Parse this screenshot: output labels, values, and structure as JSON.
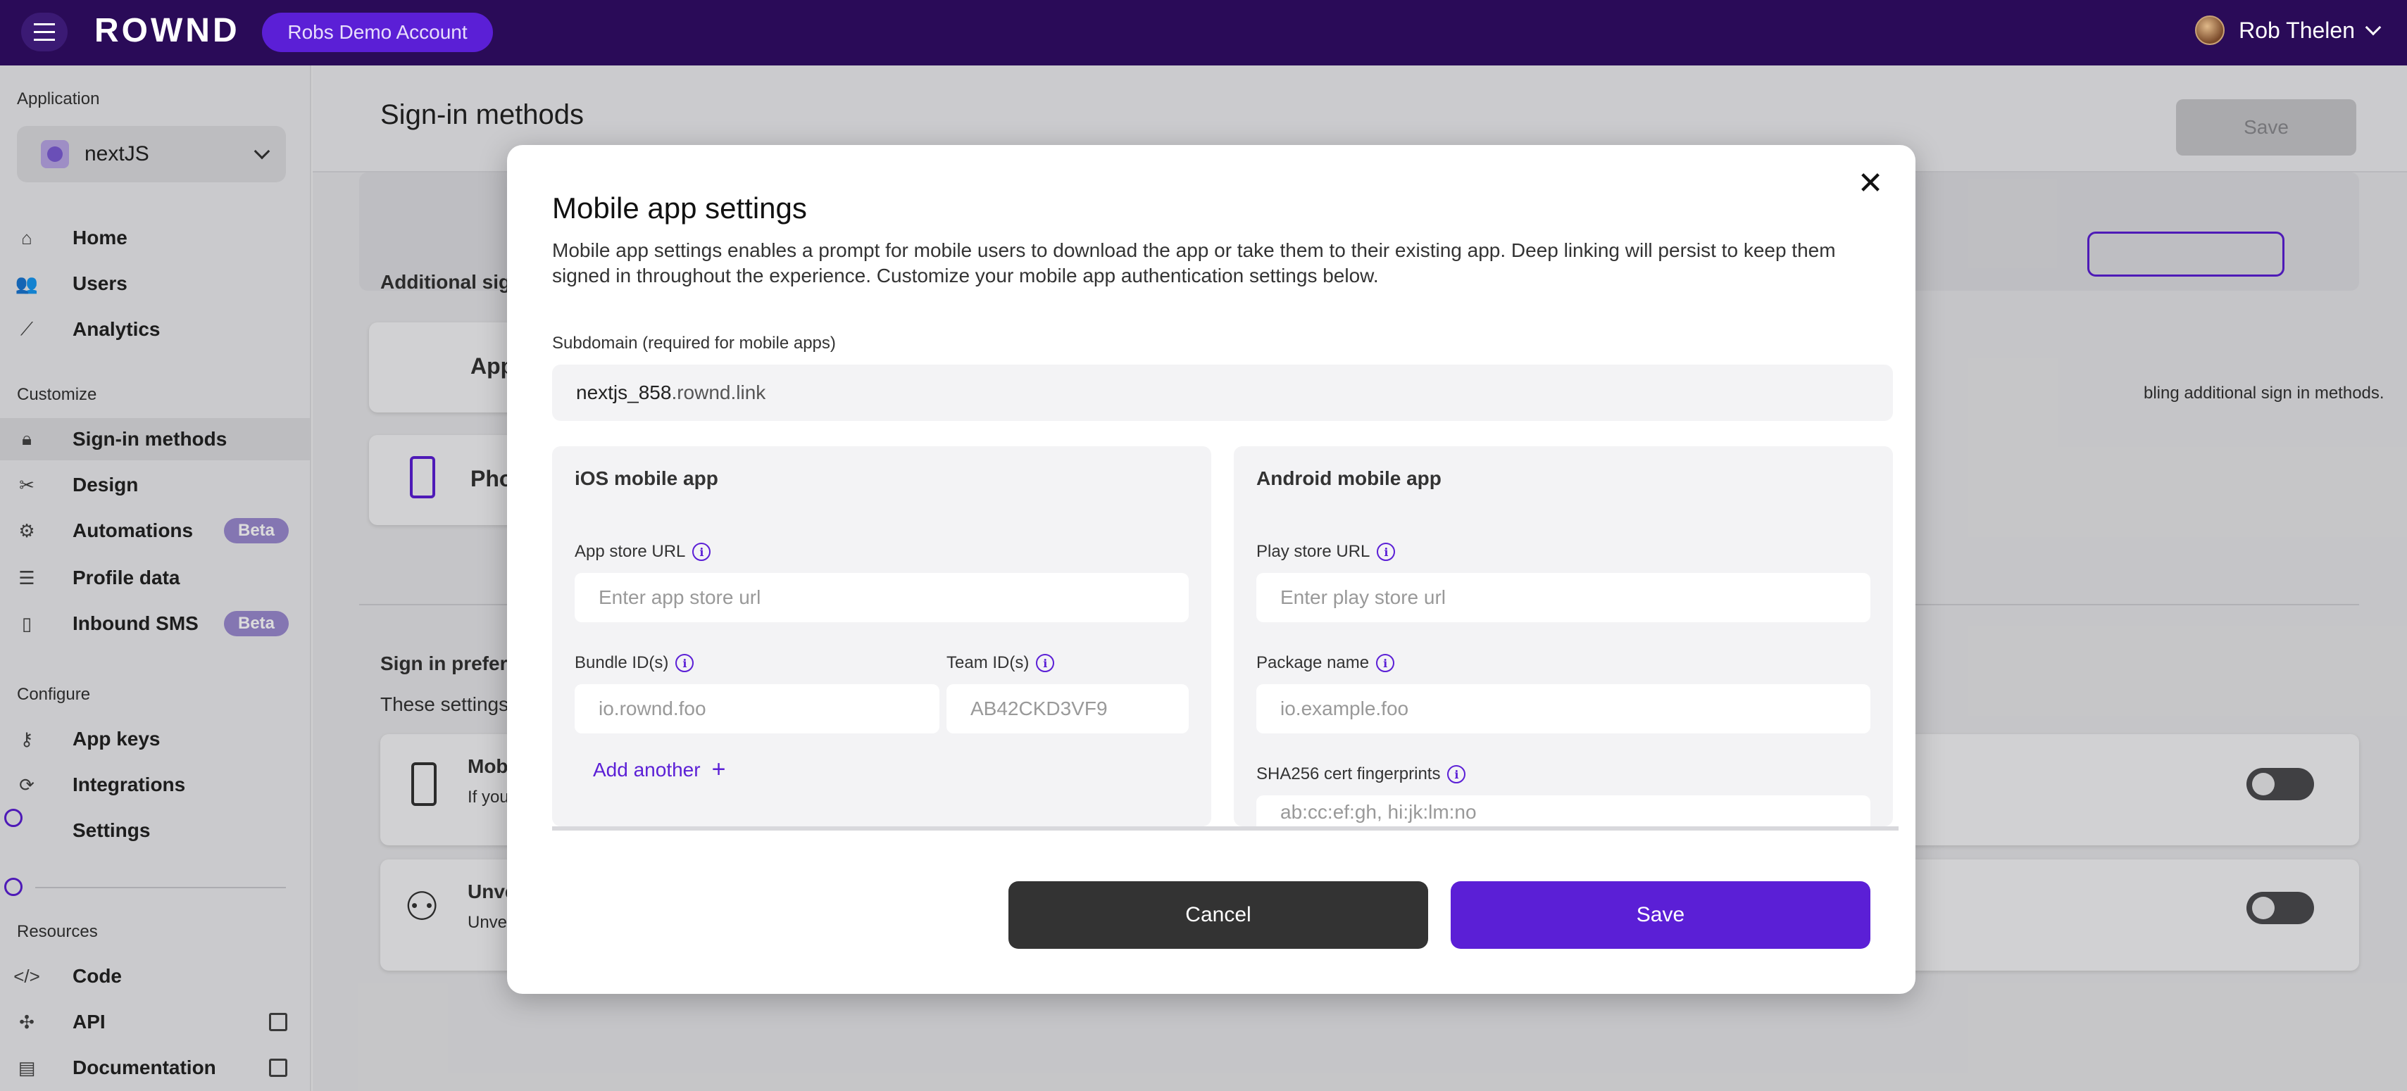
{
  "topbar": {
    "logo": "ROWND",
    "account": "Robs Demo Account",
    "user_name": "Rob Thelen"
  },
  "sidebar": {
    "application_label": "Application",
    "app_name": "nextJS",
    "main_items": [
      {
        "label": "Home",
        "icon": "home-icon"
      },
      {
        "label": "Users",
        "icon": "users-icon"
      },
      {
        "label": "Analytics",
        "icon": "analytics-icon"
      }
    ],
    "customize_label": "Customize",
    "customize_items": [
      {
        "label": "Sign-in methods",
        "icon": "lock-icon",
        "active": true
      },
      {
        "label": "Design",
        "icon": "design-icon"
      },
      {
        "label": "Automations",
        "icon": "automations-icon",
        "badge": "Beta"
      },
      {
        "label": "Profile data",
        "icon": "list-icon"
      },
      {
        "label": "Inbound SMS",
        "icon": "phone-icon",
        "badge": "Beta"
      }
    ],
    "configure_label": "Configure",
    "configure_items": [
      {
        "label": "App keys",
        "icon": "key-icon"
      },
      {
        "label": "Integrations",
        "icon": "integrations-icon"
      },
      {
        "label": "Settings",
        "icon": "settings-icon"
      }
    ],
    "resources_label": "Resources",
    "resources_items": [
      {
        "label": "Code",
        "icon": "code-icon"
      },
      {
        "label": "API",
        "icon": "api-icon",
        "external": true
      },
      {
        "label": "Documentation",
        "icon": "doc-icon",
        "external": true
      }
    ]
  },
  "page": {
    "title": "Sign-in methods",
    "save": "Save",
    "additional_heading": "Additional sign",
    "apple_label": "App",
    "phone_label": "Pho",
    "enabling_note": "bling additional sign in methods.",
    "prefs_heading": "Sign in prefere",
    "prefs_sub": "These settings",
    "mobile_title": "Mob",
    "mobile_sub": "If you",
    "unverified_title": "Unve",
    "unverified_sub": "Unve"
  },
  "modal": {
    "title": "Mobile app settings",
    "description": "Mobile app settings enables a prompt for mobile users to download the app or take them to their existing app. Deep linking will persist to keep them signed in throughout the experience. Customize your mobile app authentication settings below.",
    "subdomain_label": "Subdomain (required for mobile apps)",
    "subdomain_value": "nextjs_858",
    "subdomain_suffix": ".rownd.link",
    "ios": {
      "title": "iOS mobile app",
      "app_store_label": "App store URL",
      "app_store_placeholder": "Enter app store url",
      "bundle_label": "Bundle ID(s)",
      "bundle_placeholder": "io.rownd.foo",
      "team_label": "Team ID(s)",
      "team_placeholder": "AB42CKD3VF9",
      "add_another": "Add another"
    },
    "android": {
      "title": "Android mobile app",
      "play_store_label": "Play store URL",
      "play_store_placeholder": "Enter play store url",
      "package_label": "Package name",
      "package_placeholder": "io.example.foo",
      "sha_label": "SHA256 cert fingerprints",
      "sha_placeholder": "ab:cc:ef:gh, hi:jk:lm:no"
    },
    "cancel": "Cancel",
    "save": "Save"
  },
  "colors": {
    "topbar": "#2a0b58",
    "accent": "#5b1fd6",
    "cancel_button": "#333333"
  }
}
